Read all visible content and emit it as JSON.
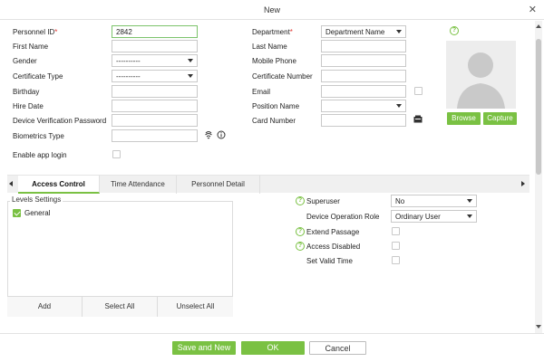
{
  "window": {
    "title": "New",
    "close_glyph": "✕"
  },
  "form_left": {
    "personnel_id_label": "Personnel ID",
    "personnel_id_value": "2842",
    "first_name_label": "First Name",
    "first_name_value": "",
    "gender_label": "Gender",
    "gender_value": "----------",
    "certificate_type_label": "Certificate Type",
    "certificate_type_value": "----------",
    "birthday_label": "Birthday",
    "birthday_value": "",
    "hire_date_label": "Hire Date",
    "hire_date_value": "",
    "device_password_label": "Device Verification Password",
    "device_password_value": "",
    "biometrics_type_label": "Biometrics Type",
    "biometrics_type_value": "",
    "enable_app_login_label": "Enable app login",
    "enable_app_login_checked": false
  },
  "form_right": {
    "department_label": "Department",
    "department_value": "Department Name",
    "last_name_label": "Last Name",
    "last_name_value": "",
    "mobile_phone_label": "Mobile Phone",
    "mobile_phone_value": "",
    "certificate_number_label": "Certificate Number",
    "certificate_number_value": "",
    "email_label": "Email",
    "email_value": "",
    "position_name_label": "Position Name",
    "position_name_value": "",
    "card_number_label": "Card Number",
    "card_number_value": ""
  },
  "photo": {
    "browse_label": "Browse",
    "capture_label": "Capture",
    "help_glyph": "?"
  },
  "tabs": [
    {
      "label": "Access Control",
      "active": true
    },
    {
      "label": "Time Attendance",
      "active": false
    },
    {
      "label": "Personnel Detail",
      "active": false
    }
  ],
  "levels": {
    "title": "Levels Settings",
    "items": [
      {
        "label": "General",
        "checked": true
      }
    ],
    "add_label": "Add",
    "select_all_label": "Select All",
    "unselect_all_label": "Unselect All"
  },
  "access": {
    "superuser_label": "Superuser",
    "superuser_value": "No",
    "device_role_label": "Device Operation Role",
    "device_role_value": "Ordinary User",
    "extend_passage_label": "Extend Passage",
    "access_disabled_label": "Access Disabled",
    "set_valid_time_label": "Set Valid Time"
  },
  "footer": {
    "save_and_new_label": "Save and New",
    "ok_label": "OK",
    "cancel_label": "Cancel"
  },
  "colors": {
    "accent": "#7ac143",
    "required": "#e53935",
    "photo_bg": "#ededed"
  }
}
